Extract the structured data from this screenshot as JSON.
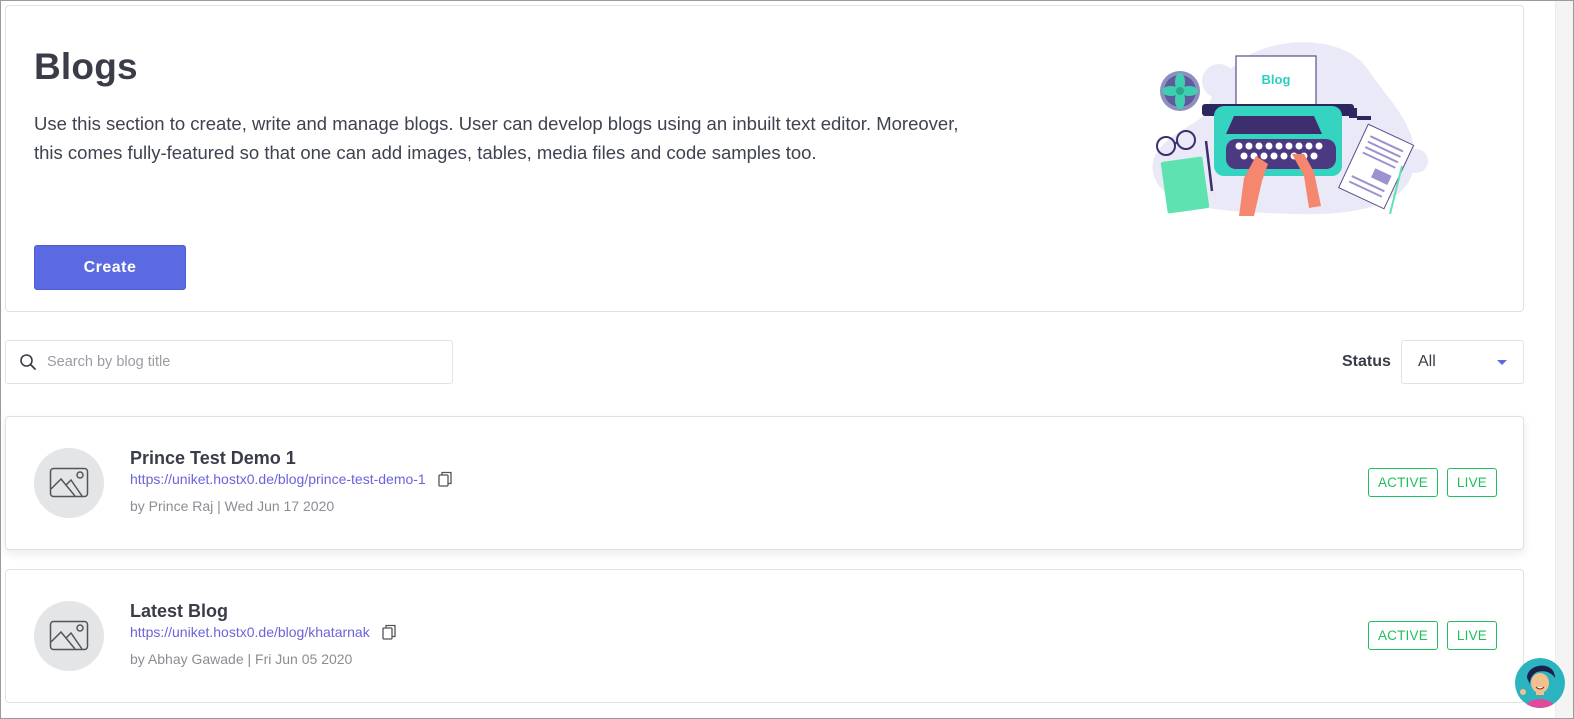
{
  "header": {
    "title": "Blogs",
    "description": "Use this section to create, write and manage blogs. User can develop blogs using an inbuilt text editor. Moreover, this comes fully-featured so that one can add images, tables, media files and code samples too.",
    "create_label": "Create",
    "illustration_text": "Blog"
  },
  "filters": {
    "search": {
      "placeholder": "Search by blog title",
      "value": ""
    },
    "status_label": "Status",
    "status_value": "All"
  },
  "blogs": [
    {
      "title": "Prince Test Demo 1",
      "url": "https://uniket.hostx0.de/blog/prince-test-demo-1",
      "meta": "by Prince Raj | Wed Jun 17 2020",
      "badges": [
        "ACTIVE",
        "LIVE"
      ]
    },
    {
      "title": "Latest Blog",
      "url": "https://uniket.hostx0.de/blog/khatarnak",
      "meta": "by Abhay Gawade | Fri Jun 05 2020",
      "badges": [
        "ACTIVE",
        "LIVE"
      ]
    }
  ],
  "colors": {
    "primary": "#5b6ae0",
    "link": "#6b63d9",
    "badge_green": "#1fbf5b",
    "text_dark": "#3a3d47"
  }
}
